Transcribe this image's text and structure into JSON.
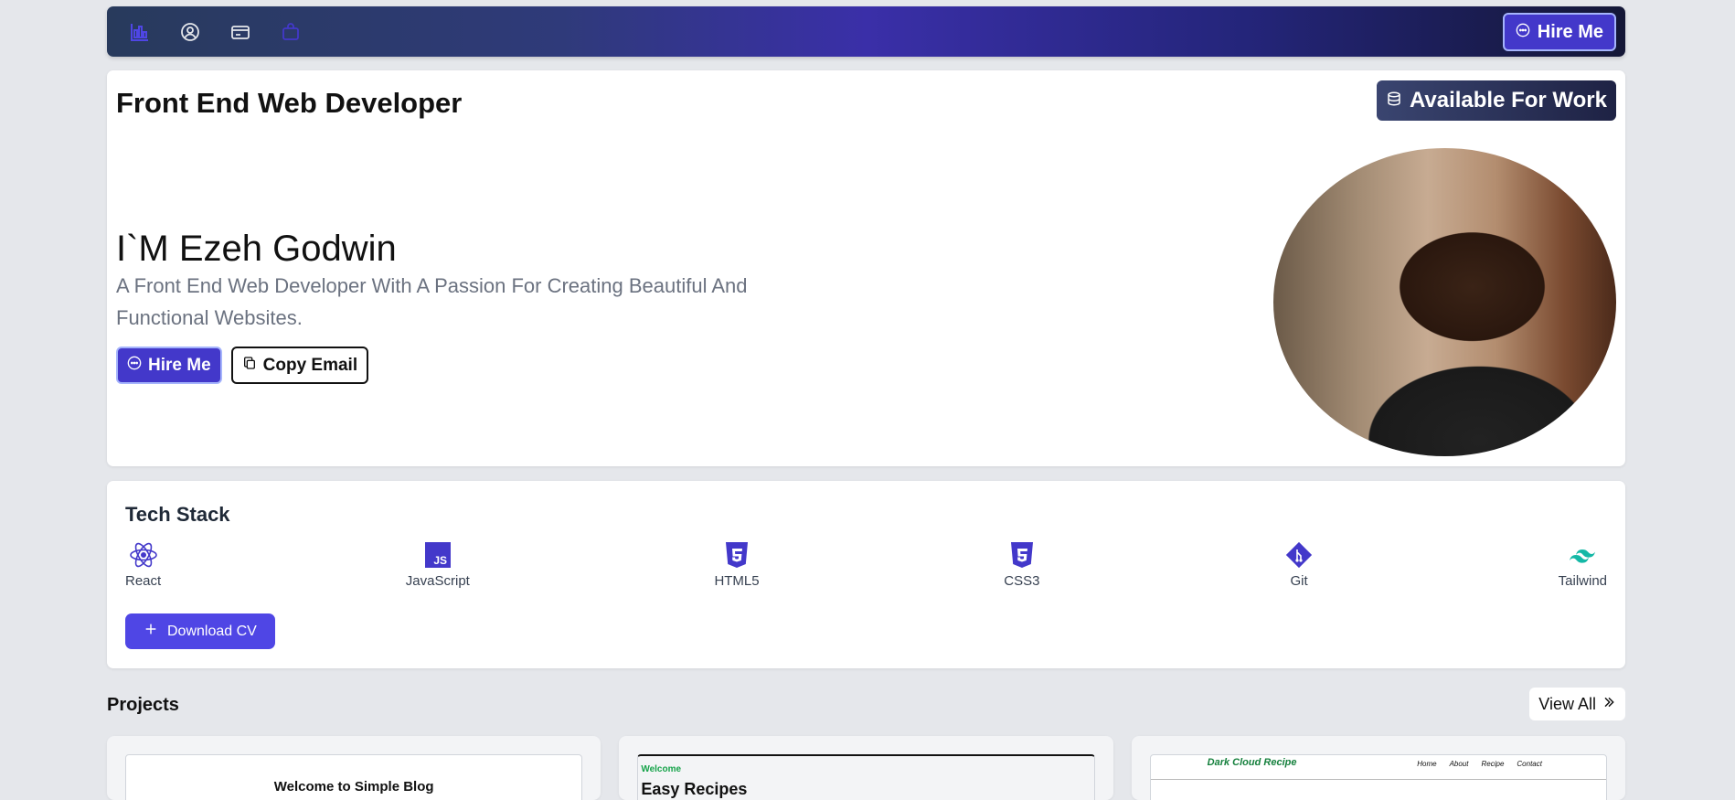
{
  "nav": {
    "icons": [
      "chart-icon",
      "user-icon",
      "card-icon",
      "bag-icon"
    ],
    "hire_label": "Hire Me"
  },
  "hero": {
    "role": "Front End Web Developer",
    "availability": "Available For Work",
    "name": "I`M Ezeh Godwin",
    "description": "A Front End Web Developer With A Passion For Creating Beautiful And Functional Websites.",
    "hire_label": "Hire Me",
    "copy_label": "Copy Email"
  },
  "tech": {
    "title": "Tech Stack",
    "items": [
      {
        "label": "React",
        "icon": "react-icon"
      },
      {
        "label": "JavaScript",
        "icon": "javascript-icon"
      },
      {
        "label": "HTML5",
        "icon": "html5-icon"
      },
      {
        "label": "CSS3",
        "icon": "css3-icon"
      },
      {
        "label": "Git",
        "icon": "git-icon"
      },
      {
        "label": "Tailwind",
        "icon": "tailwind-icon"
      }
    ],
    "cv_label": "Download CV"
  },
  "projects": {
    "title": "Projects",
    "view_all": "View All",
    "cards": [
      {
        "heading": "Welcome to Simple Blog"
      },
      {
        "welcome": "Welcome",
        "heading": "Easy Recipes"
      },
      {
        "brand": "Dark Cloud Recipe",
        "nav": [
          "Home",
          "About",
          "Recipe",
          "Contact"
        ]
      }
    ]
  },
  "colors": {
    "accent": "#4338ca",
    "accent_light": "#a5b4fc",
    "tech_icon": "#4338ca",
    "tailwind": "#14b8a6"
  }
}
